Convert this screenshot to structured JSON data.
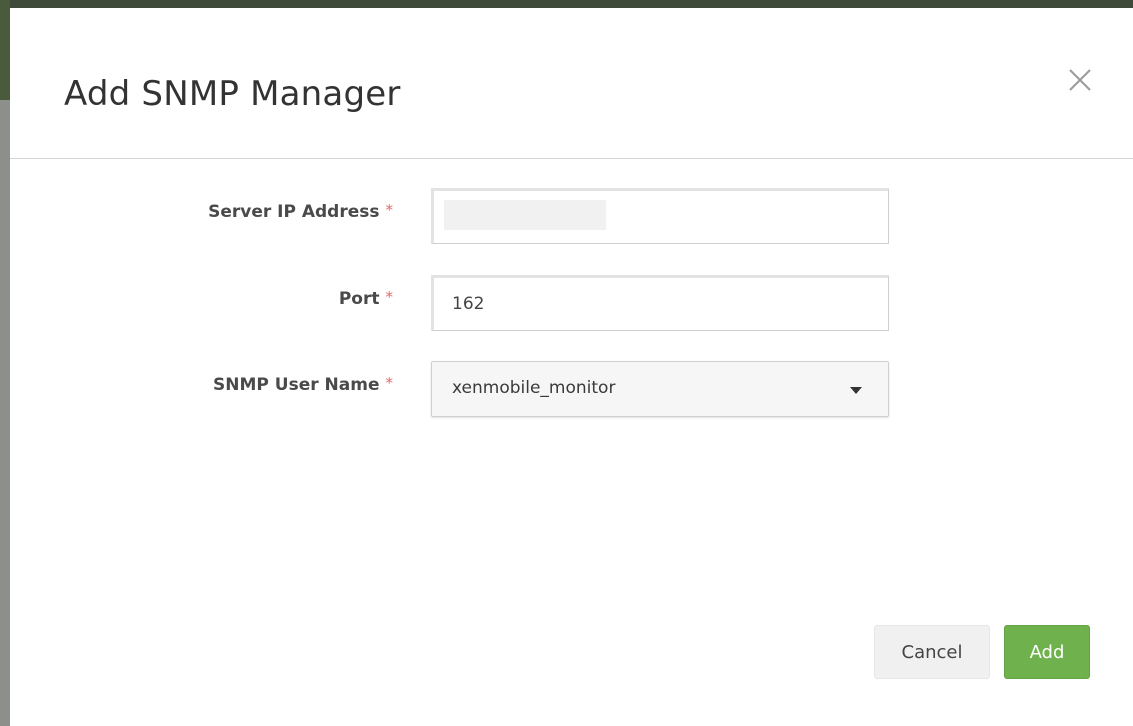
{
  "dialog": {
    "title": "Add SNMP Manager",
    "close_icon": "close-icon"
  },
  "form": {
    "server_ip": {
      "label": "Server IP Address",
      "required_mark": "*",
      "value": ""
    },
    "port": {
      "label": "Port",
      "required_mark": "*",
      "value": "162"
    },
    "snmp_user": {
      "label": "SNMP User Name",
      "required_mark": "*",
      "selected": "xenmobile_monitor",
      "caret_icon": "caret-down-icon"
    }
  },
  "footer": {
    "cancel_label": "Cancel",
    "add_label": "Add"
  },
  "colors": {
    "add_button": "#6fb24d",
    "required_star": "#e06a6a",
    "cancel_button": "#f0f0f0"
  }
}
